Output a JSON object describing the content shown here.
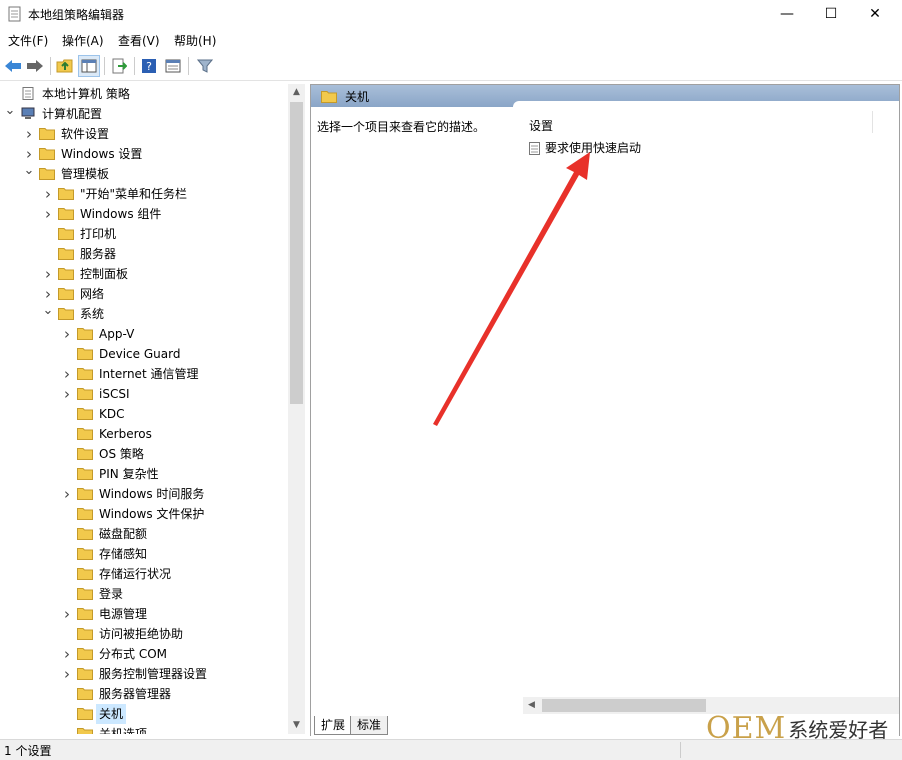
{
  "window": {
    "title": "本地组策略编辑器"
  },
  "menu": [
    "文件(F)",
    "操作(A)",
    "查看(V)",
    "帮助(H)"
  ],
  "tree": [
    {
      "label": "本地计算机 策略",
      "level": 0,
      "exp": "",
      "icon": "policy-icon"
    },
    {
      "label": "计算机配置",
      "level": 0,
      "exp": "v",
      "icon": "computer-icon"
    },
    {
      "label": "软件设置",
      "level": 1,
      "exp": ">",
      "icon": "folder-icon"
    },
    {
      "label": "Windows 设置",
      "level": 1,
      "exp": ">",
      "icon": "folder-icon"
    },
    {
      "label": "管理模板",
      "level": 1,
      "exp": "v",
      "icon": "folder-icon"
    },
    {
      "label": "\"开始\"菜单和任务栏",
      "level": 2,
      "exp": ">",
      "icon": "folder-icon"
    },
    {
      "label": "Windows 组件",
      "level": 2,
      "exp": ">",
      "icon": "folder-icon"
    },
    {
      "label": "打印机",
      "level": 2,
      "exp": "",
      "icon": "folder-icon"
    },
    {
      "label": "服务器",
      "level": 2,
      "exp": "",
      "icon": "folder-icon"
    },
    {
      "label": "控制面板",
      "level": 2,
      "exp": ">",
      "icon": "folder-icon"
    },
    {
      "label": "网络",
      "level": 2,
      "exp": ">",
      "icon": "folder-icon"
    },
    {
      "label": "系统",
      "level": 2,
      "exp": "v",
      "icon": "folder-icon"
    },
    {
      "label": "App-V",
      "level": 3,
      "exp": ">",
      "icon": "folder-icon"
    },
    {
      "label": "Device Guard",
      "level": 3,
      "exp": "",
      "icon": "folder-icon"
    },
    {
      "label": "Internet 通信管理",
      "level": 3,
      "exp": ">",
      "icon": "folder-icon"
    },
    {
      "label": "iSCSI",
      "level": 3,
      "exp": ">",
      "icon": "folder-icon"
    },
    {
      "label": "KDC",
      "level": 3,
      "exp": "",
      "icon": "folder-icon"
    },
    {
      "label": "Kerberos",
      "level": 3,
      "exp": "",
      "icon": "folder-icon"
    },
    {
      "label": "OS 策略",
      "level": 3,
      "exp": "",
      "icon": "folder-icon"
    },
    {
      "label": "PIN 复杂性",
      "level": 3,
      "exp": "",
      "icon": "folder-icon"
    },
    {
      "label": "Windows 时间服务",
      "level": 3,
      "exp": ">",
      "icon": "folder-icon"
    },
    {
      "label": "Windows 文件保护",
      "level": 3,
      "exp": "",
      "icon": "folder-icon"
    },
    {
      "label": "磁盘配额",
      "level": 3,
      "exp": "",
      "icon": "folder-icon"
    },
    {
      "label": "存储感知",
      "level": 3,
      "exp": "",
      "icon": "folder-icon"
    },
    {
      "label": "存储运行状况",
      "level": 3,
      "exp": "",
      "icon": "folder-icon"
    },
    {
      "label": "登录",
      "level": 3,
      "exp": "",
      "icon": "folder-icon"
    },
    {
      "label": "电源管理",
      "level": 3,
      "exp": ">",
      "icon": "folder-icon"
    },
    {
      "label": "访问被拒绝协助",
      "level": 3,
      "exp": "",
      "icon": "folder-icon"
    },
    {
      "label": "分布式 COM",
      "level": 3,
      "exp": ">",
      "icon": "folder-icon"
    },
    {
      "label": "服务控制管理器设置",
      "level": 3,
      "exp": ">",
      "icon": "folder-icon"
    },
    {
      "label": "服务器管理器",
      "level": 3,
      "exp": "",
      "icon": "folder-icon"
    },
    {
      "label": "关机",
      "level": 3,
      "exp": "",
      "icon": "folder-icon",
      "selected": true
    },
    {
      "label": "关机选项",
      "level": 3,
      "exp": "",
      "icon": "folder-icon"
    }
  ],
  "right": {
    "header": "关机",
    "description": "选择一个项目来查看它的描述。",
    "column_header": "设置",
    "settings": [
      "要求使用快速启动"
    ]
  },
  "tabs": [
    "扩展",
    "标准"
  ],
  "status": "1 个设置",
  "watermark": {
    "oem": "OEM",
    "text": "系统爱好者"
  },
  "colors": {
    "folder": "#f2c94c",
    "header": "#8aa5c7",
    "arrow": "#e8312a",
    "selection": "#cce8ff"
  }
}
